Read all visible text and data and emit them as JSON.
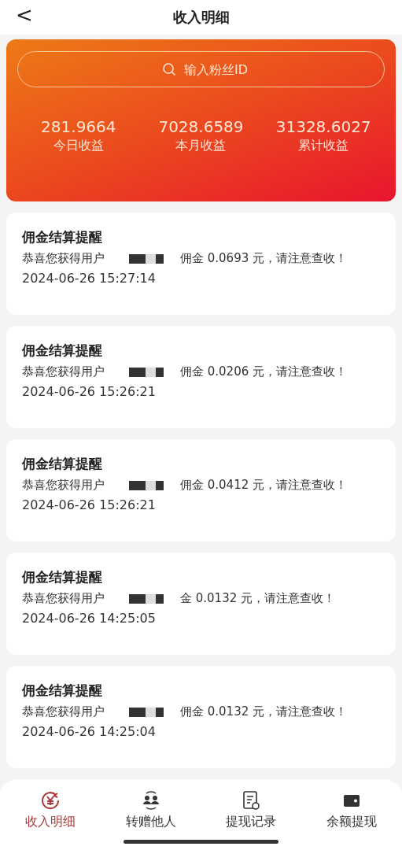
{
  "header": {
    "back": "<",
    "title": "收入明细"
  },
  "summary": {
    "search": {
      "placeholder": "输入粉丝ID"
    },
    "stats": [
      {
        "value": "281.9664",
        "label": "今日收益"
      },
      {
        "value": "7028.6589",
        "label": "本月收益"
      },
      {
        "value": "31328.6027",
        "label": "累计收益"
      }
    ]
  },
  "notices": [
    {
      "title": "佣金结算提醒",
      "before": "恭喜您获得用户",
      "after": "佣金 0.0693 元，请注意查收！",
      "time": "2024-06-26 15:27:14"
    },
    {
      "title": "佣金结算提醒",
      "before": "恭喜您获得用户",
      "after": "佣金 0.0206 元，请注意查收！",
      "time": "2024-06-26 15:26:21"
    },
    {
      "title": "佣金结算提醒",
      "before": "恭喜您获得用户",
      "after": "佣金 0.0412 元，请注意查收！",
      "time": "2024-06-26 15:26:21"
    },
    {
      "title": "佣金结算提醒",
      "before": "恭喜您获得用户",
      "after": "金 0.0132 元，请注意查收！",
      "time": "2024-06-26 14:25:05"
    },
    {
      "title": "佣金结算提醒",
      "before": "恭喜您获得用户",
      "after": "佣金 0.0132 元，请注意查收！",
      "time": "2024-06-26 14:25:04"
    }
  ],
  "tabs": [
    {
      "kind": "income",
      "label": "收入明细",
      "selected": true
    },
    {
      "kind": "transfer",
      "label": "转赠他人",
      "selected": false
    },
    {
      "kind": "records",
      "label": "提现记录",
      "selected": false
    },
    {
      "kind": "wallet",
      "label": "余额提现",
      "selected": false
    }
  ]
}
